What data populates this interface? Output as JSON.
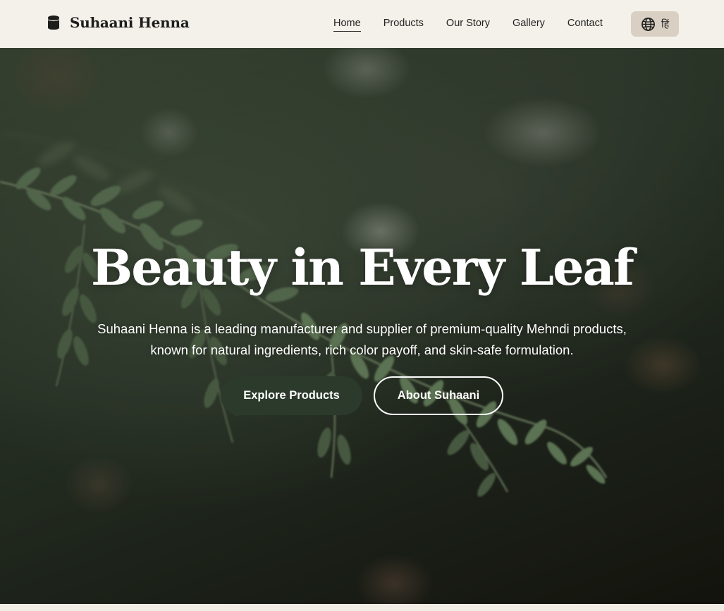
{
  "header": {
    "brand_name": "Suhaani Henna",
    "brand_icon": "jar-icon",
    "nav": [
      {
        "label": "Home",
        "active": true
      },
      {
        "label": "Products",
        "active": false
      },
      {
        "label": "Our Story",
        "active": false
      },
      {
        "label": "Gallery",
        "active": false
      },
      {
        "label": "Contact",
        "active": false
      }
    ],
    "language_button": {
      "icon": "globe-icon",
      "label": "हिं"
    }
  },
  "hero": {
    "title": "Beauty in Every Leaf",
    "subtitle": "Suhaani Henna is a leading manufacturer and supplier of premium-quality Mehndi products, known for natural ingredients, rich color payoff, and skin-safe formulation.",
    "primary_button": "Explore Products",
    "secondary_button": "About Suhaani"
  },
  "colors": {
    "header_bg": "#f4f1ea",
    "primary_button_bg": "#2b3a2b",
    "language_button_bg": "#d9cfc2",
    "hero_text": "#ffffff"
  }
}
